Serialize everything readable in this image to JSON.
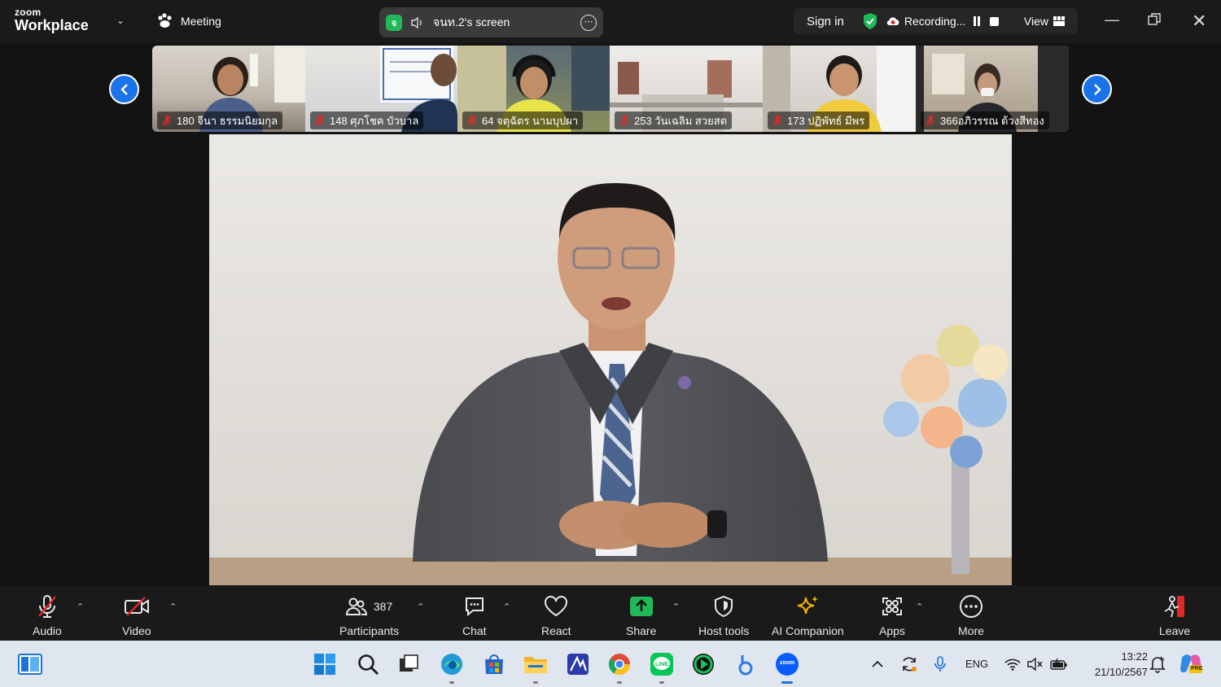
{
  "app": {
    "brand_small": "zoom",
    "brand_main": "Workplace",
    "meeting_label": "Meeting",
    "share_badge": "จ",
    "share_label": "จนท.2's screen",
    "sign_in": "Sign in",
    "recording_label": "Recording...",
    "view_label": "View"
  },
  "participants": [
    {
      "label": "180  จีนา ธรรมนิยมกุล"
    },
    {
      "label": "148 ศุภโชค บัวบาล"
    },
    {
      "label": "64 จตุฉัตร  นามบุปผา"
    },
    {
      "label": "253 วันเฉลิม สวยสด"
    },
    {
      "label": "173 ปฏิพัทธ์ มีพร"
    },
    {
      "label": "366อภิวรรณ ด้วงสีทอง"
    }
  ],
  "toolbar": {
    "audio": "Audio",
    "video": "Video",
    "participants_count": "387",
    "participants": "Participants",
    "chat": "Chat",
    "react": "React",
    "share": "Share",
    "host_tools": "Host tools",
    "ai_companion": "AI Companion",
    "apps": "Apps",
    "more": "More",
    "leave": "Leave"
  },
  "taskbar": {
    "language": "ENG",
    "time": "13:22",
    "date": "21/10/2567",
    "zoom_badge": "zoom",
    "copilot_badge": "PRE"
  },
  "colors": {
    "accent_blue": "#1a73e8",
    "share_green": "#21b858",
    "leave_red": "#e02828",
    "ai_gold": "#f5b800"
  }
}
